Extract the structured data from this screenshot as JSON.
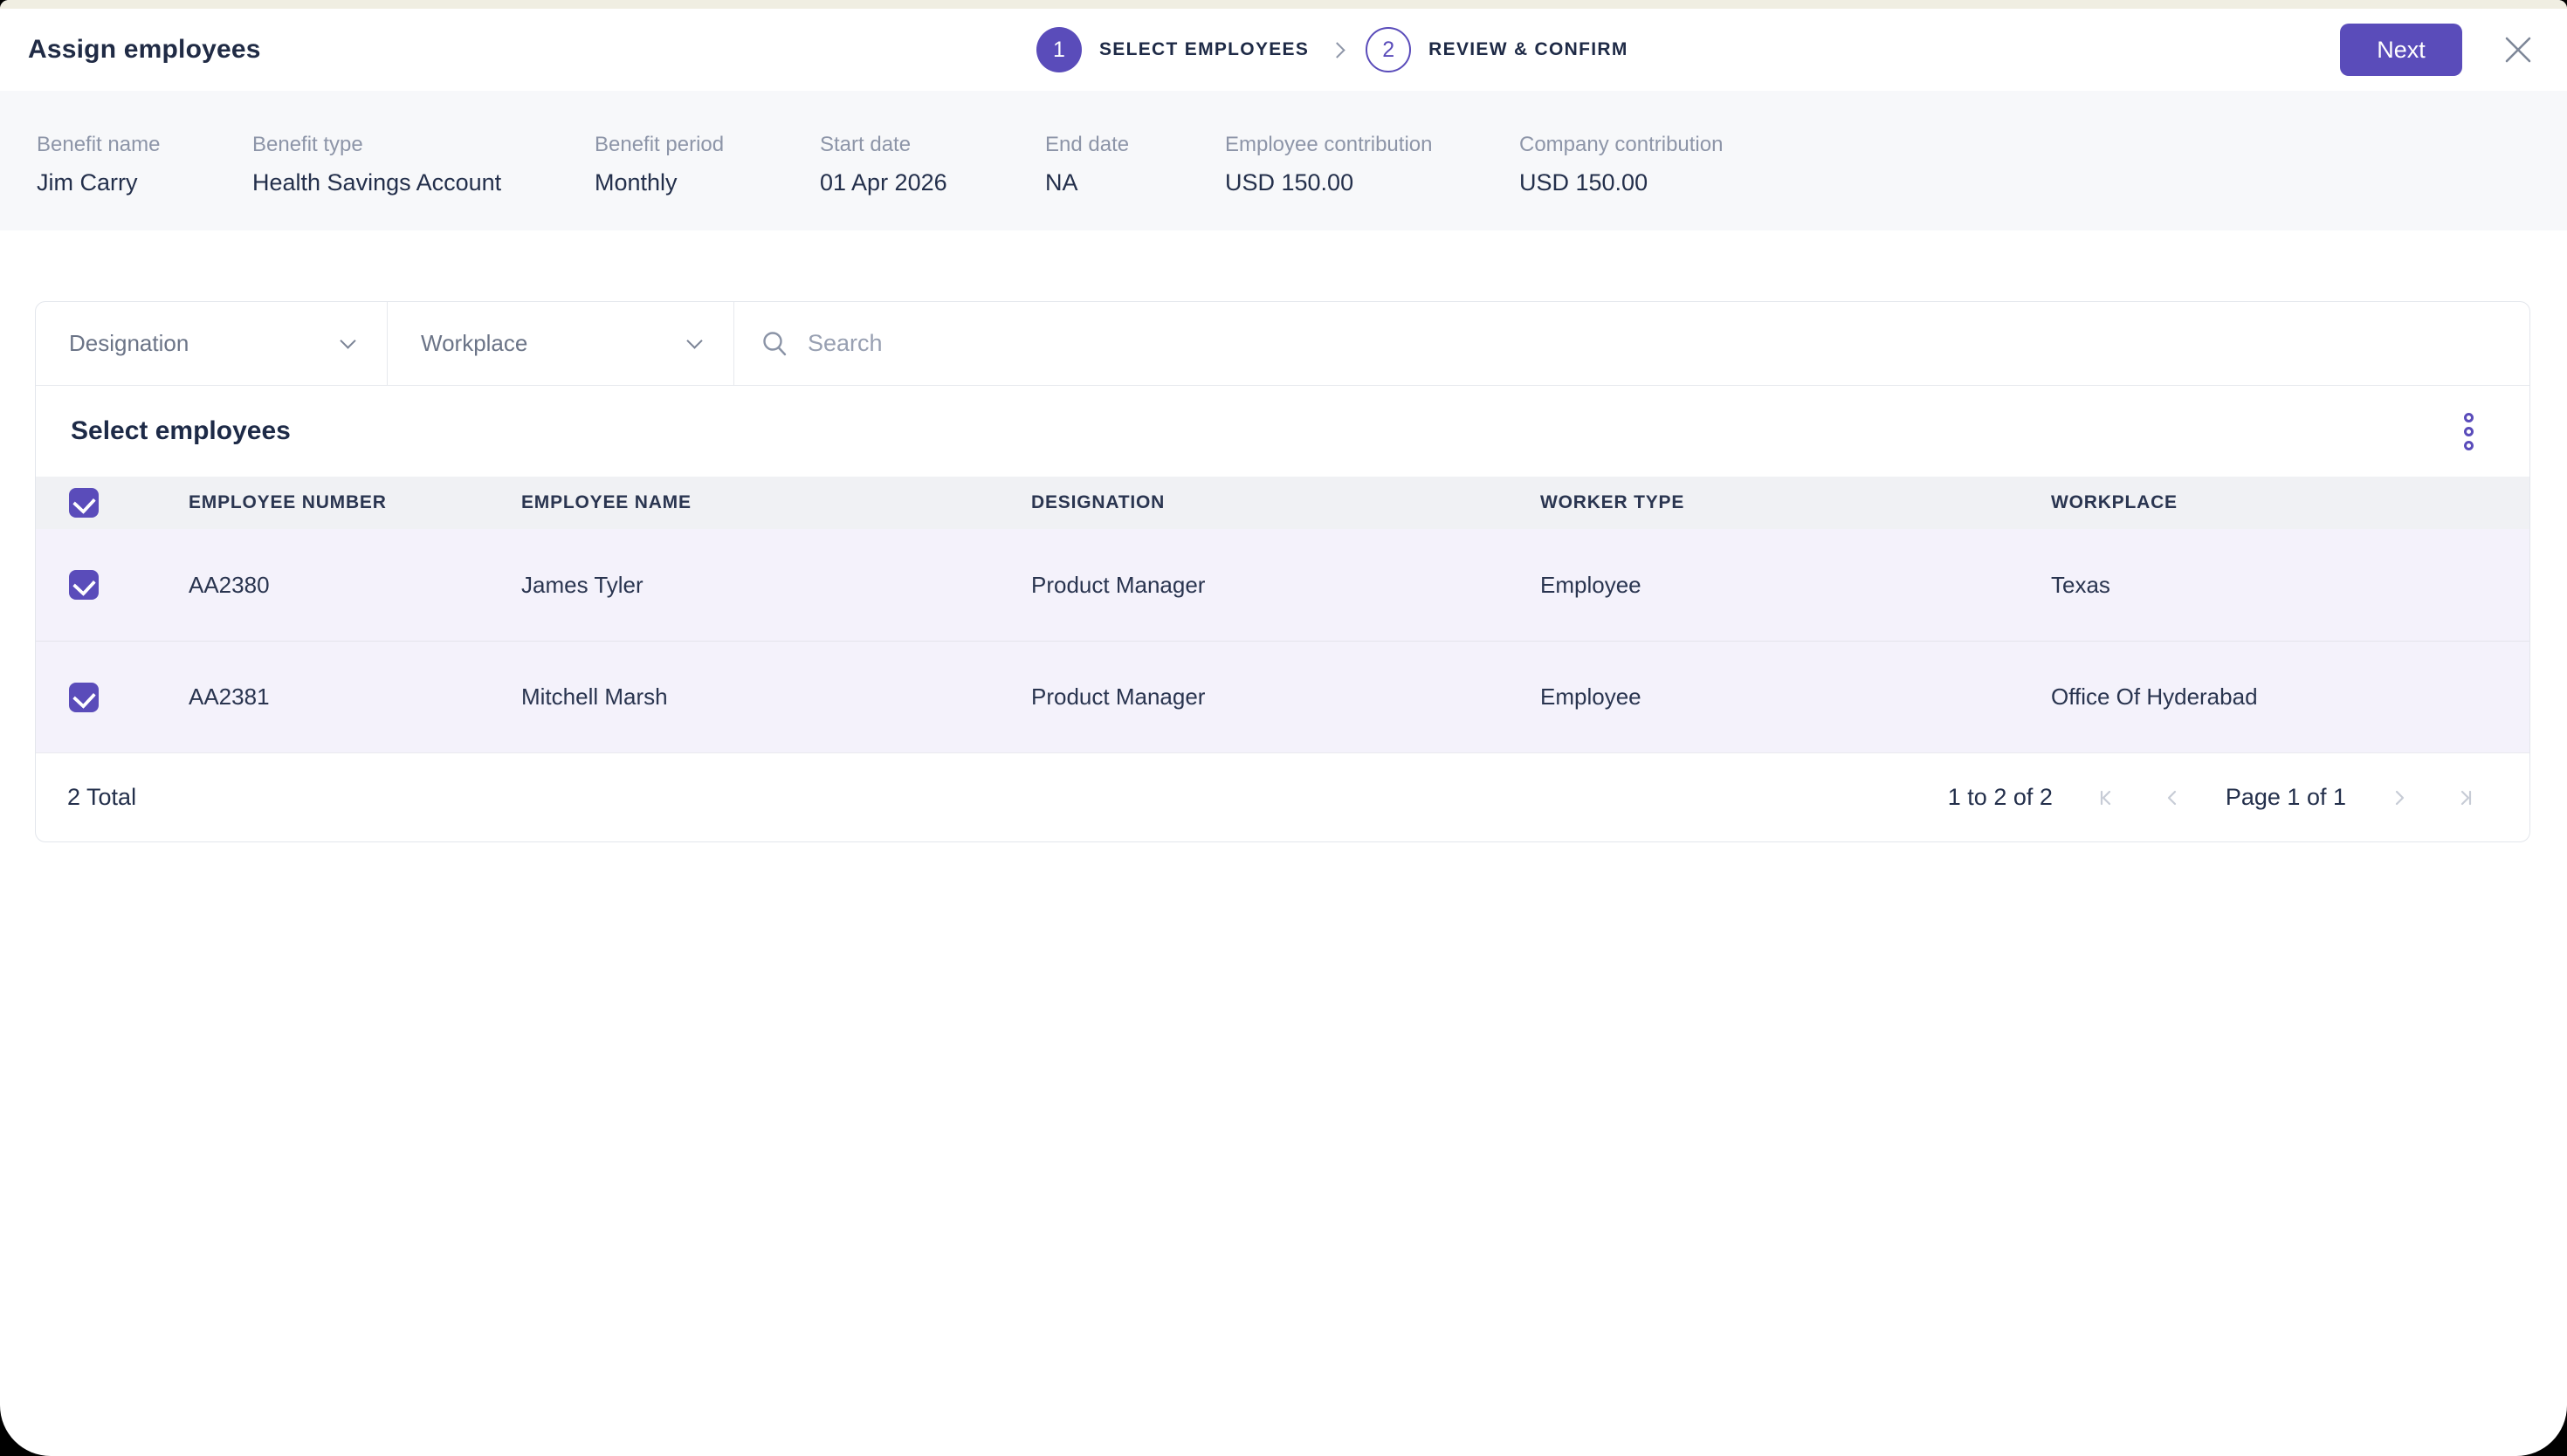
{
  "colors": {
    "accent": "#5a4cba",
    "app_strip": "#f0eee2",
    "summary_bg": "#f7f8fa",
    "table_header_bg": "#f0f1f4",
    "selected_row_bg": "#f4f2fb"
  },
  "header": {
    "title": "Assign employees",
    "next_label": "Next",
    "steps": [
      {
        "number": "1",
        "label": "SELECT EMPLOYEES",
        "state": "active"
      },
      {
        "number": "2",
        "label": "REVIEW & CONFIRM",
        "state": "upcoming"
      }
    ]
  },
  "benefit_summary": {
    "fields": [
      {
        "label": "Benefit name",
        "value": "Jim Carry"
      },
      {
        "label": "Benefit type",
        "value": "Health Savings Account"
      },
      {
        "label": "Benefit period",
        "value": "Monthly"
      },
      {
        "label": "Start date",
        "value": "01 Apr 2026"
      },
      {
        "label": "End date",
        "value": "NA"
      },
      {
        "label": "Employee contribution",
        "value": "USD 150.00"
      },
      {
        "label": "Company contribution",
        "value": "USD 150.00"
      }
    ]
  },
  "filters": {
    "designation_label": "Designation",
    "workplace_label": "Workplace",
    "search_placeholder": "Search"
  },
  "table": {
    "title": "Select employees",
    "header_checked": true,
    "columns": [
      "EMPLOYEE NUMBER",
      "EMPLOYEE NAME",
      "DESIGNATION",
      "WORKER TYPE",
      "WORKPLACE"
    ],
    "rows": [
      {
        "selected": true,
        "number": "AA2380",
        "name": "James Tyler",
        "designation": "Product Manager",
        "worker_type": "Employee",
        "workplace": "Texas"
      },
      {
        "selected": true,
        "number": "AA2381",
        "name": "Mitchell Marsh",
        "designation": "Product Manager",
        "worker_type": "Employee",
        "workplace": "Office Of Hyderabad"
      }
    ]
  },
  "footer": {
    "total": "2 Total",
    "range": "1 to 2 of 2",
    "page": "Page 1 of 1"
  }
}
